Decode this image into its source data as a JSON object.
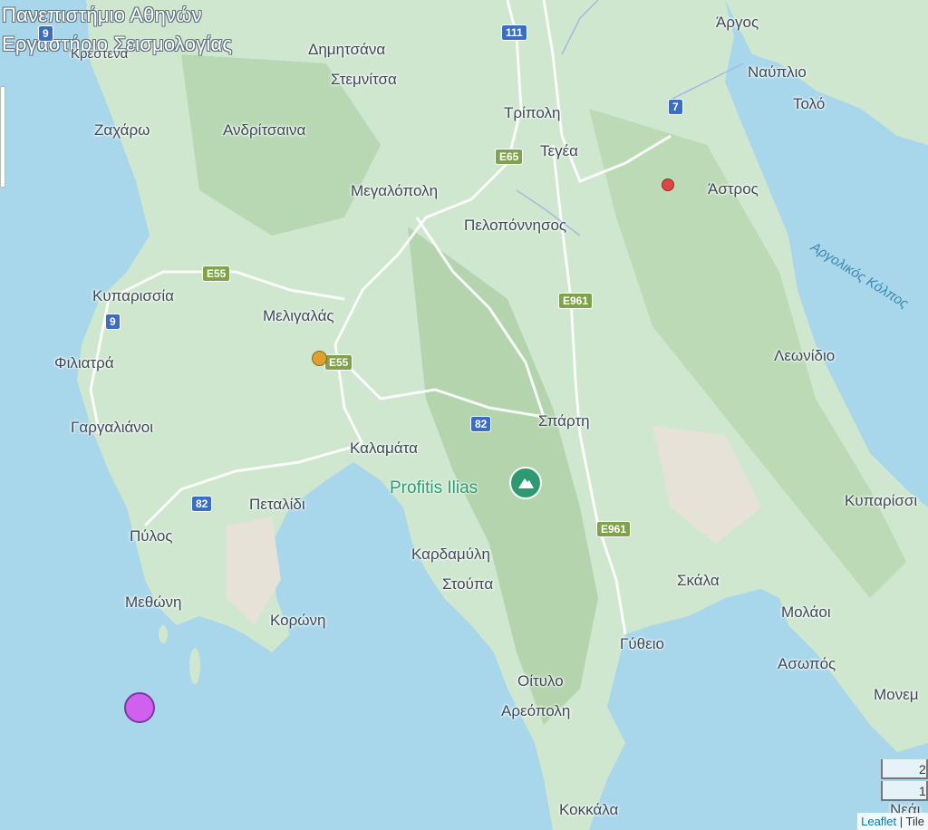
{
  "overlay": {
    "title_line1": "Πανεπιστήμιο Αθηνών",
    "title_line2": "Εργαστήριο Σεισμολογίας"
  },
  "places": [
    {
      "id": "argos",
      "text": "Άργος"
    },
    {
      "id": "dimitsana",
      "text": "Δημητσάνα"
    },
    {
      "id": "stemnitsa",
      "text": "Στεμνίτσα"
    },
    {
      "id": "nafplio",
      "text": "Ναύπλιο"
    },
    {
      "id": "tolo",
      "text": "Τολό"
    },
    {
      "id": "tripoli",
      "text": "Τρίπολη"
    },
    {
      "id": "zacharo",
      "text": "Ζαχάρω"
    },
    {
      "id": "andritsaina",
      "text": "Ανδρίτσαινα"
    },
    {
      "id": "tegea",
      "text": "Τεγέα"
    },
    {
      "id": "astros",
      "text": "Άστρος"
    },
    {
      "id": "megalopoli",
      "text": "Μεγαλόπολη"
    },
    {
      "id": "peloponnisos",
      "text": "Πελοπόννησος"
    },
    {
      "id": "kyparissia",
      "text": "Κυπαρισσία"
    },
    {
      "id": "meligalas",
      "text": "Μελιγαλάς"
    },
    {
      "id": "leonidio",
      "text": "Λεωνίδιο"
    },
    {
      "id": "filiatra",
      "text": "Φιλιατρά"
    },
    {
      "id": "gargalianoi",
      "text": "Γαργαλιάνοι"
    },
    {
      "id": "sparti",
      "text": "Σπάρτη"
    },
    {
      "id": "kalamata",
      "text": "Καλαμάτα"
    },
    {
      "id": "petalidi",
      "text": "Πεταλίδι"
    },
    {
      "id": "kyparissi",
      "text": "Κυπαρίσσι"
    },
    {
      "id": "pylos",
      "text": "Πύλος"
    },
    {
      "id": "kardamyli",
      "text": "Καρδαμύλη"
    },
    {
      "id": "stoupa",
      "text": "Στούπα"
    },
    {
      "id": "skala",
      "text": "Σκάλα"
    },
    {
      "id": "methoni",
      "text": "Μεθώνη"
    },
    {
      "id": "koroni",
      "text": "Κορώνη"
    },
    {
      "id": "molaoi",
      "text": "Μολάοι"
    },
    {
      "id": "gytheio",
      "text": "Γύθειο"
    },
    {
      "id": "asopos",
      "text": "Ασωπός"
    },
    {
      "id": "oitylo",
      "text": "Οίτυλο"
    },
    {
      "id": "monemvasia",
      "text": "Μονεμ"
    },
    {
      "id": "areopoli",
      "text": "Αρεόπολη"
    },
    {
      "id": "kokkala",
      "text": "Κοκκάλα"
    },
    {
      "id": "neapoli",
      "text": "Νεάι"
    },
    {
      "id": "kiparissia_top",
      "text": "Κρέστενα"
    }
  ],
  "sea_label": "Αργολικός Κόλπος",
  "poi": {
    "label": "Profitis Ilias",
    "icon": "mountain-icon"
  },
  "shields": [
    {
      "id": "r111",
      "text": "111",
      "style": "blue"
    },
    {
      "id": "r7",
      "text": "7",
      "style": "blue"
    },
    {
      "id": "e65",
      "text": "E65",
      "style": "green"
    },
    {
      "id": "e55a",
      "text": "E55",
      "style": "green"
    },
    {
      "id": "r9",
      "text": "9",
      "style": "blue"
    },
    {
      "id": "e961a",
      "text": "E961",
      "style": "green"
    },
    {
      "id": "e55b",
      "text": "E55",
      "style": "green"
    },
    {
      "id": "r82a",
      "text": "82",
      "style": "blue"
    },
    {
      "id": "r82b",
      "text": "82",
      "style": "blue"
    },
    {
      "id": "e961b",
      "text": "E961",
      "style": "green"
    },
    {
      "id": "r9top",
      "text": "9",
      "style": "blue"
    }
  ],
  "markers": [
    {
      "id": "quake-red",
      "color": "#e04545"
    },
    {
      "id": "quake-orange",
      "color": "#e0a030"
    },
    {
      "id": "quake-purple",
      "color": "#d060f0"
    }
  ],
  "scale": {
    "top": "2",
    "bottom": "1"
  },
  "attribution": {
    "leaflet": "Leaflet",
    "sep": " | ",
    "tiles": "Tile"
  }
}
